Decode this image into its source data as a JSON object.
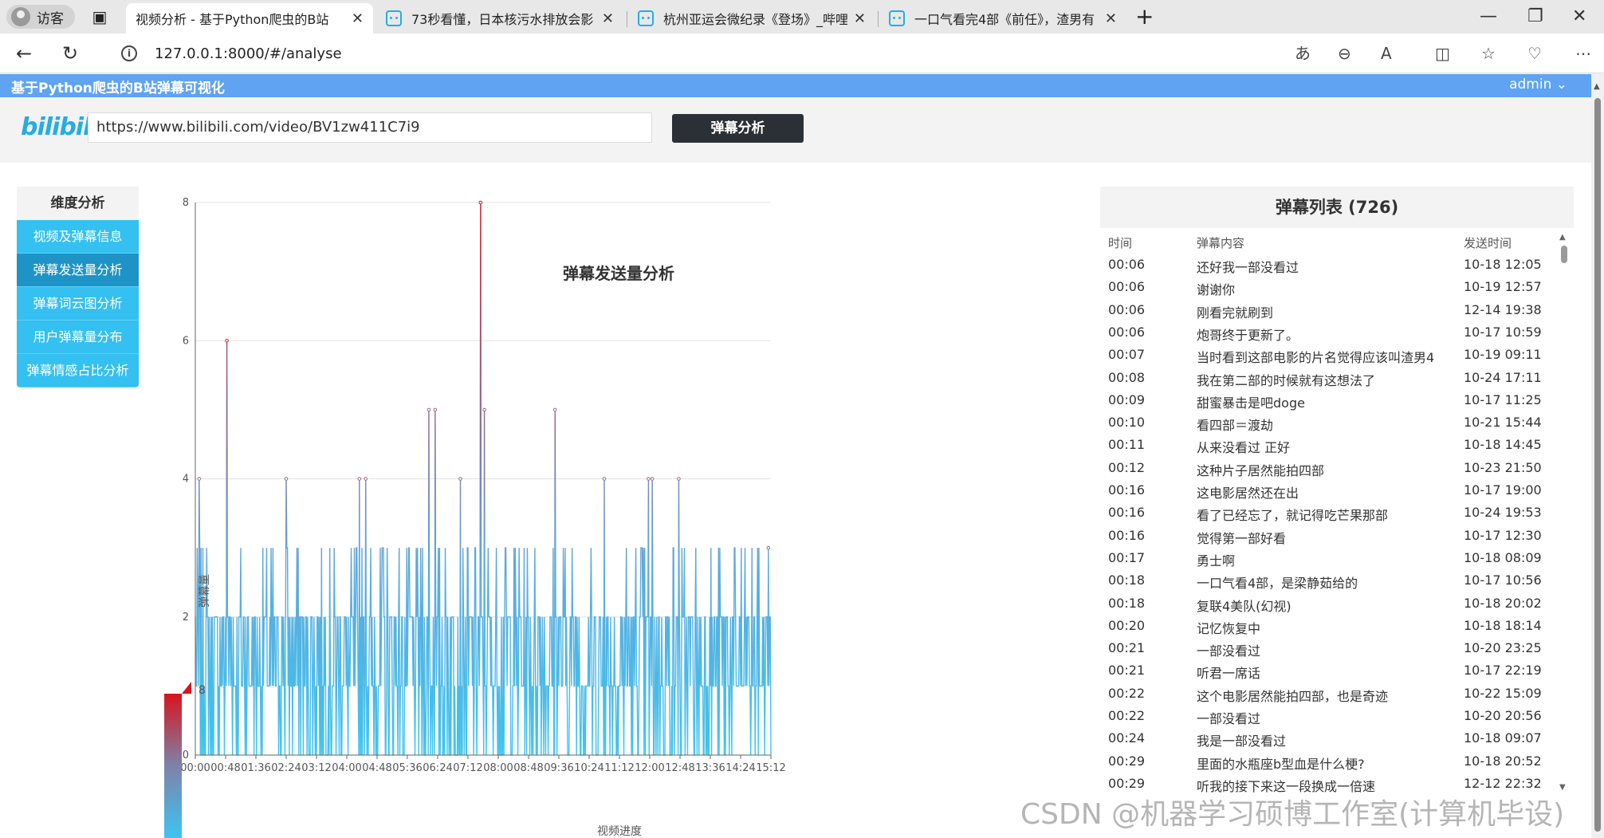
{
  "browser": {
    "profile_label": "访客",
    "tabs": [
      {
        "title": "视频分析 - 基于Python爬虫的B站",
        "active": true
      },
      {
        "title": "73秒看懂，日本核污水排放会影",
        "active": false
      },
      {
        "title": "杭州亚运会微纪录《登场》_哔哩",
        "active": false
      },
      {
        "title": "一口气看完4部《前任》，渣男有",
        "active": false
      }
    ],
    "url": "127.0.0.1:8000/#/analyse"
  },
  "app": {
    "brand": "基于Python爬虫的B站弹幕可视化",
    "user": "admin ⌄",
    "logo": "bilibili",
    "video_url": "https://www.bilibili.com/video/BV1zw411C7i9",
    "analyze_button": "弹幕分析"
  },
  "sidebar": {
    "header": "维度分析",
    "items": [
      {
        "label": "视频及弹幕信息",
        "selected": false
      },
      {
        "label": "弹幕发送量分析",
        "selected": true
      },
      {
        "label": "弹幕词云图分析",
        "selected": false
      },
      {
        "label": "用户弹幕量分布",
        "selected": false
      },
      {
        "label": "弹幕情感占比分析",
        "selected": false
      }
    ]
  },
  "chart_data": {
    "type": "line",
    "title": "弹幕发送量分析",
    "xlabel": "视频进度",
    "ylabel": "弹幕量",
    "ylim": [
      0,
      8
    ],
    "yticks": [
      0,
      2,
      4,
      6,
      8
    ],
    "xticks": [
      "00:00",
      "00:48",
      "01:36",
      "02:24",
      "03:12",
      "04:00",
      "04:48",
      "05:36",
      "06:24",
      "07:12",
      "08:00",
      "08:48",
      "09:36",
      "10:24",
      "11:12",
      "12:00",
      "12:48",
      "13:36",
      "14:24",
      "15:12"
    ],
    "x_range_seconds": [
      0,
      912
    ],
    "visual_map": {
      "min": 0,
      "max": 8,
      "colors": [
        "#3ec4f0",
        "#d7141f"
      ]
    },
    "peaks": [
      {
        "x": "00:06",
        "y": 4
      },
      {
        "x": "00:50",
        "y": 6
      },
      {
        "x": "02:24",
        "y": 4
      },
      {
        "x": "04:20",
        "y": 4
      },
      {
        "x": "04:30",
        "y": 4
      },
      {
        "x": "06:10",
        "y": 5
      },
      {
        "x": "06:20",
        "y": 5
      },
      {
        "x": "07:00",
        "y": 4
      },
      {
        "x": "07:32",
        "y": 8
      },
      {
        "x": "07:38",
        "y": 5
      },
      {
        "x": "09:30",
        "y": 5
      },
      {
        "x": "10:48",
        "y": 4
      },
      {
        "x": "11:58",
        "y": 4
      },
      {
        "x": "12:04",
        "y": 4
      },
      {
        "x": "12:46",
        "y": 4
      },
      {
        "x": "15:08",
        "y": 3
      }
    ],
    "baseline_values": [
      0,
      1,
      2,
      3
    ],
    "grid": true
  },
  "danmaku": {
    "title": "弹幕列表 (726)",
    "columns": [
      "时间",
      "弹幕内容",
      "发送时间"
    ],
    "rows": [
      [
        "00:06",
        "还好我一部没看过",
        "10-18 12:05"
      ],
      [
        "00:06",
        "谢谢你",
        "10-19 12:57"
      ],
      [
        "00:06",
        "刚看完就刷到",
        "12-14 19:38"
      ],
      [
        "00:06",
        "炮哥终于更新了。",
        "10-17 10:59"
      ],
      [
        "00:07",
        "当时看到这部电影的片名觉得应该叫渣男4",
        "10-19 09:11"
      ],
      [
        "00:08",
        "我在第二部的时候就有这想法了",
        "10-24 17:11"
      ],
      [
        "00:09",
        "甜蜜暴击是吧doge",
        "10-17 11:25"
      ],
      [
        "00:10",
        "看四部＝渡劫",
        "10-21 15:44"
      ],
      [
        "00:11",
        "从来没看过 正好",
        "10-18 14:45"
      ],
      [
        "00:12",
        "这种片子居然能拍四部",
        "10-23 21:50"
      ],
      [
        "00:16",
        "这电影居然还在出",
        "10-17 19:00"
      ],
      [
        "00:16",
        "看了已经忘了，就记得吃芒果那部",
        "10-24 19:53"
      ],
      [
        "00:16",
        "觉得第一部好看",
        "10-17 12:30"
      ],
      [
        "00:17",
        "勇士啊",
        "10-18 08:09"
      ],
      [
        "00:18",
        "一口气看4部，是梁静茹给的",
        "10-17 10:56"
      ],
      [
        "00:18",
        "复联4美队(幻视)",
        "10-18 20:02"
      ],
      [
        "00:20",
        "记忆恢复中",
        "10-18 18:14"
      ],
      [
        "00:21",
        "一部没看过",
        "10-20 23:25"
      ],
      [
        "00:21",
        "听君一席话",
        "10-17 22:19"
      ],
      [
        "00:22",
        "这个电影居然能拍四部，也是奇迹",
        "10-22 15:09"
      ],
      [
        "00:22",
        "一部没看过",
        "10-20 20:56"
      ],
      [
        "00:24",
        "我是一部没看过",
        "10-18 09:07"
      ],
      [
        "00:29",
        "里面的水瓶座b型血是什么梗?",
        "10-18 20:52"
      ],
      [
        "00:29",
        "听我的接下来这一段换成一倍速",
        "12-12 22:32"
      ]
    ]
  },
  "watermark": "CSDN @机器学习硕博工作室(计算机毕设)"
}
